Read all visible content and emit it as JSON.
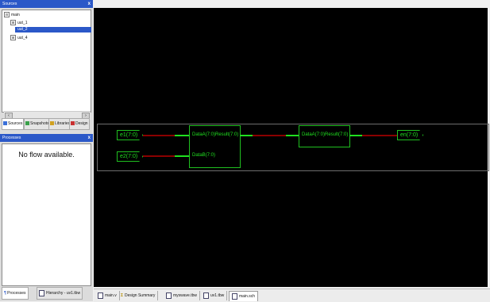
{
  "sources": {
    "title": "Sources",
    "close": "x",
    "tree": [
      {
        "label": "main",
        "expander": "⊟",
        "selected": false
      },
      {
        "label": "uut_1",
        "expander": "⊞",
        "selected": false
      },
      {
        "label": "uut_2",
        "expander": "",
        "selected": true
      },
      {
        "label": "uut_4",
        "expander": "⊞",
        "selected": false
      }
    ],
    "tabs": [
      "Sources",
      "Snapshots",
      "Libraries",
      "Design"
    ]
  },
  "processes": {
    "title": "Processes",
    "close": "x",
    "message": "No flow available."
  },
  "left_tabs": [
    "Processes",
    "Hierarchy - uv1.tbw"
  ],
  "schematic": {
    "ports_in": [
      "e1(7:0)",
      "e2(7:0)"
    ],
    "port_out": "en(7:0)",
    "block1": {
      "pin_a": "DataA(7:0)",
      "pin_b": "DataB(7:0)",
      "pin_result": "Result(7:0)"
    },
    "block2": {
      "pin_a": "DataA(7:0)",
      "pin_result": "Result(7:0)"
    }
  },
  "bottom_tabs": [
    {
      "label": "main.v",
      "icon": "file-icon",
      "active": false
    },
    {
      "label": "Design Summary",
      "icon": "sigma-icon",
      "active": false
    },
    {
      "label": "myswave.tbw",
      "icon": "waveform-icon",
      "active": false
    },
    {
      "label": "uv1.tbw",
      "icon": "waveform-icon",
      "active": false
    },
    {
      "label": "main.sch",
      "icon": "file-icon",
      "active": true
    }
  ],
  "colors": {
    "wire_green": "#20e020",
    "wire_red": "#8b0000",
    "title_blue": "#2b58c8",
    "canvas": "#000000"
  }
}
